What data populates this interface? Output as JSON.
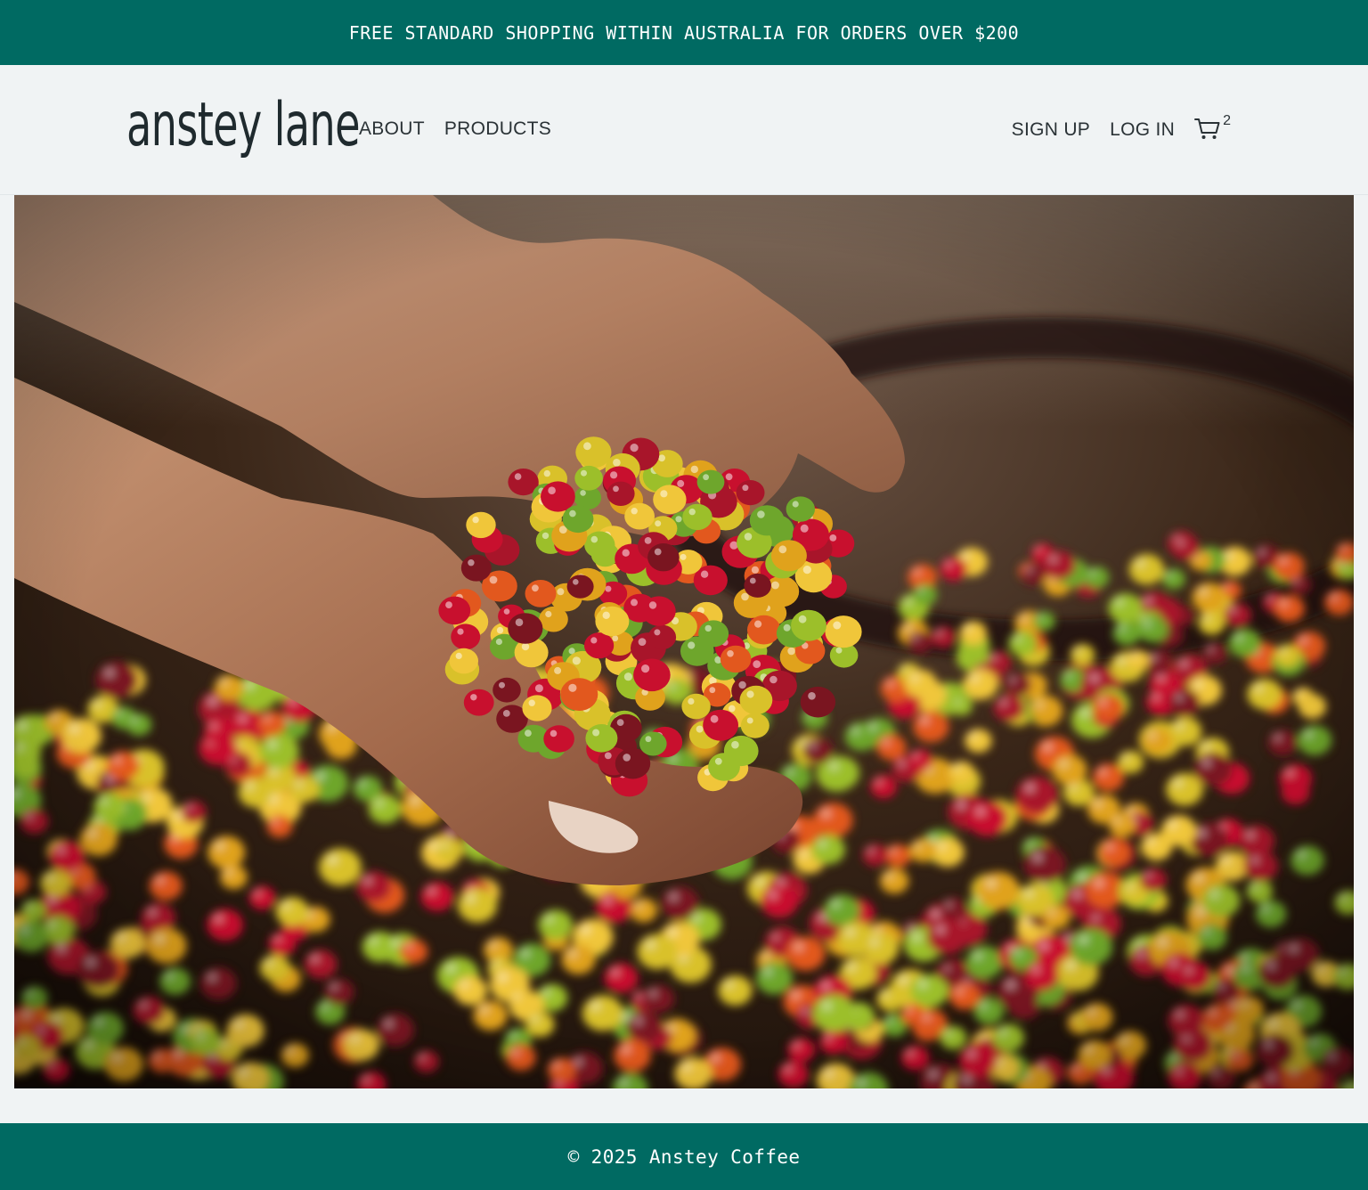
{
  "announcement": {
    "text": "FREE STANDARD SHOPPING WITHIN AUSTRALIA FOR ORDERS OVER $200"
  },
  "header": {
    "logo_text": "anstey lane",
    "nav_left": [
      {
        "label": "ABOUT"
      },
      {
        "label": "PRODUCTS"
      }
    ],
    "nav_right": [
      {
        "label": "SIGN UP"
      },
      {
        "label": "LOG IN"
      }
    ],
    "cart": {
      "icon": "shopping-cart-icon",
      "count": "2"
    }
  },
  "hero": {
    "image": "hands holding freshly picked red, yellow and green coffee cherries over a basket"
  },
  "footer": {
    "text": "© 2025 Anstey Coffee"
  },
  "colors": {
    "brand_teal": "#006a62",
    "header_bg": "#f0f3f4",
    "text_dark": "#2a3236"
  }
}
